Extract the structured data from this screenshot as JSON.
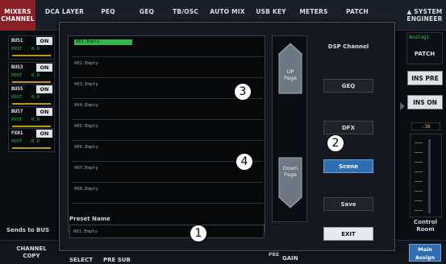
{
  "topbar": {
    "tabs": [
      {
        "label": "MIXERS",
        "sub": "CHANNEL",
        "active": true
      },
      {
        "label": "DCA LAYER",
        "sub": "",
        "active": false
      },
      {
        "label": "PEQ",
        "sub": "",
        "active": false
      },
      {
        "label": "GEQ",
        "sub": "",
        "active": false
      },
      {
        "label": "TB/OSC",
        "sub": "",
        "active": false
      },
      {
        "label": "AUTO MIX",
        "sub": "",
        "active": false
      },
      {
        "label": "USB KEY",
        "sub": "",
        "active": false
      },
      {
        "label": "METERS",
        "sub": "",
        "active": false
      },
      {
        "label": "PATCH",
        "sub": "",
        "active": false
      },
      {
        "label": "▲ SYSTEM",
        "sub": "ENGINEER",
        "active": false
      }
    ]
  },
  "strips": [
    {
      "name": "BUS1",
      "on": "ON",
      "mode": "POST",
      "value": "0.0"
    },
    {
      "name": "BUS3",
      "on": "ON",
      "mode": "POST",
      "value": "0.0"
    },
    {
      "name": "BUS5",
      "on": "ON",
      "mode": "POST",
      "value": "0.0"
    },
    {
      "name": "BUS7",
      "on": "ON",
      "mode": "POST",
      "value": "0.0"
    },
    {
      "name": "FX01",
      "on": "ON",
      "mode": "POST",
      "value": "0.0"
    }
  ],
  "sends_label": "Sends to BUS",
  "bottom": {
    "channel_copy": [
      "CHANNEL",
      "COPY"
    ],
    "select": "SELECT",
    "pre_sub": "PRE SUB",
    "pre": "PRE",
    "gain": "GAIN"
  },
  "right_panel": {
    "channel": "Analog1",
    "patch": "PATCH",
    "ins_pre": "INS PRE",
    "ins_on": "INS ON",
    "level": "-18",
    "control_room": [
      "Control",
      "Room"
    ],
    "main_assign": [
      "Main",
      "Assign"
    ]
  },
  "dialog": {
    "presets": [
      {
        "label": "001.Empty",
        "selected": true
      },
      {
        "label": "002.Empty",
        "selected": false
      },
      {
        "label": "003.Empty",
        "selected": false
      },
      {
        "label": "004.Empty",
        "selected": false
      },
      {
        "label": "005.Empty",
        "selected": false
      },
      {
        "label": "006.Empty",
        "selected": false
      },
      {
        "label": "007.Empty",
        "selected": false
      },
      {
        "label": "008.Empty",
        "selected": false
      }
    ],
    "preset_name_label": "Preset Name",
    "preset_name_value": "001.Empty",
    "up_page": [
      "UP",
      "Page"
    ],
    "down_page": [
      "Down",
      "Page"
    ],
    "buttons": {
      "dsp_channel": "DSP Channel",
      "geq": "GEQ",
      "dfx": "DFX",
      "scene": "Scene",
      "save": "Save",
      "exit": "EXIT"
    }
  },
  "callouts": [
    "1",
    "2",
    "3",
    "4"
  ]
}
